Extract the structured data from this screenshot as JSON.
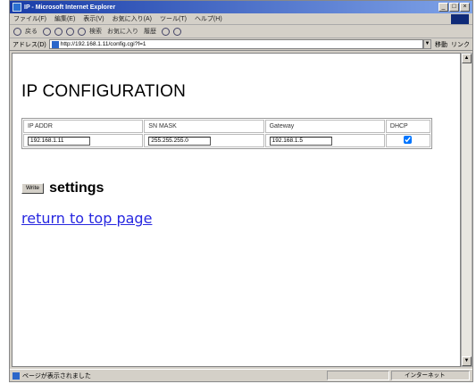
{
  "window": {
    "title": "IP - Microsoft Internet Explorer",
    "controls": [
      "_",
      "□",
      "×"
    ]
  },
  "menu": {
    "items": [
      "ファイル(F)",
      "編集(E)",
      "表示(V)",
      "お気に入り(A)",
      "ツール(T)",
      "ヘルプ(H)"
    ]
  },
  "toolbar": {
    "back": "戻る",
    "search": "検索",
    "favorites": "お気に入り",
    "history": "履歴"
  },
  "address": {
    "label": "アドレス(D)",
    "url": "http://192.168.1.11/config.cgi?f=1",
    "go": "移動",
    "links": "リンク"
  },
  "page": {
    "title": "IP CONFIGURATION",
    "headers": [
      "IP ADDR",
      "SN MASK",
      "Gateway",
      "DHCP"
    ],
    "ip_value": "192.168.1.11",
    "mask_value": "255.255.255.0",
    "gateway_value": "192.168.1.5",
    "dhcp_checked": true,
    "write_label": "Write",
    "settings_label": "settings",
    "return_link": "return to top page"
  },
  "status": {
    "text": "ページが表示されました",
    "zone": "インターネット"
  }
}
